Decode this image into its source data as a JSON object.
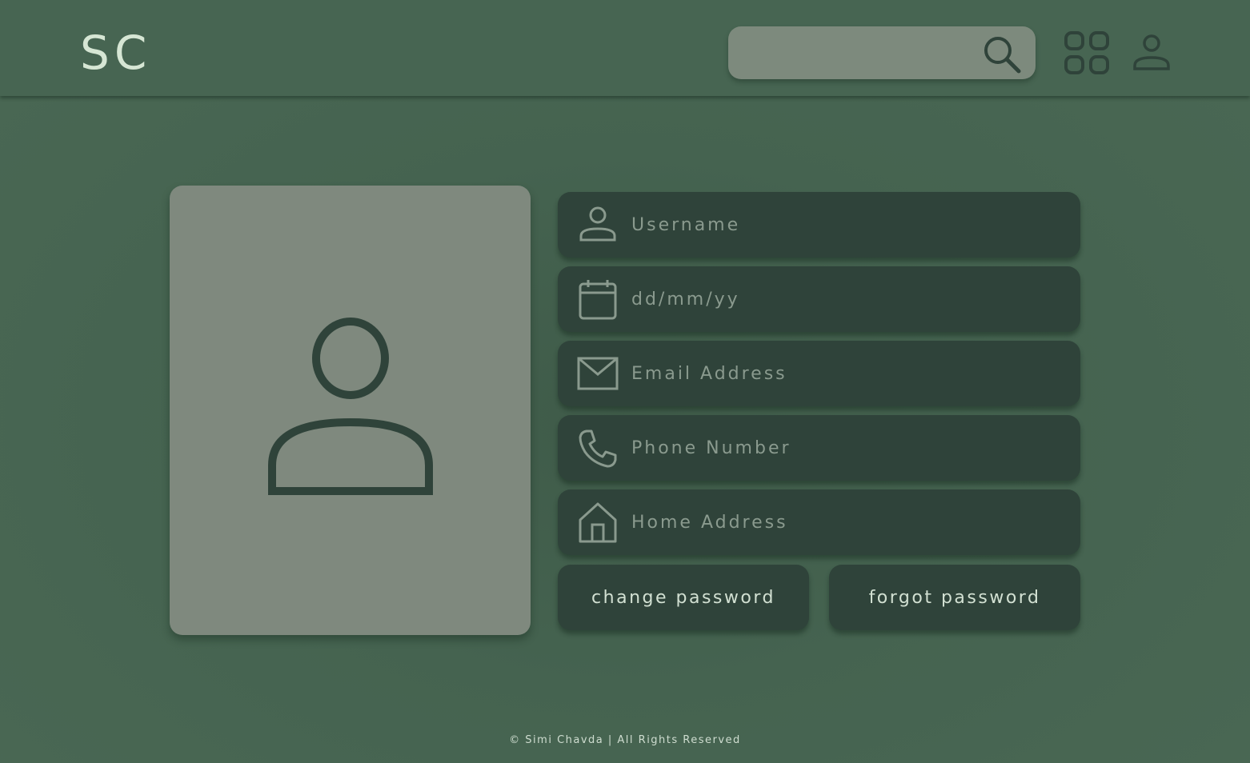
{
  "header": {
    "logo": "SC",
    "search": {
      "placeholder": "",
      "icon": "search-icon"
    },
    "apps_icon": "apps-grid-icon",
    "profile_icon": "user-icon"
  },
  "profile": {
    "photo_icon": "user-avatar-icon"
  },
  "form": {
    "fields": [
      {
        "icon": "user-icon",
        "placeholder": "Username"
      },
      {
        "icon": "calendar-icon",
        "placeholder": "dd/mm/yy"
      },
      {
        "icon": "envelope-icon",
        "placeholder": "Email Address"
      },
      {
        "icon": "phone-icon",
        "placeholder": "Phone Number"
      },
      {
        "icon": "home-icon",
        "placeholder": "Home Address"
      }
    ],
    "change_password_label": "change password",
    "forgot_password_label": "forgot password"
  },
  "footer": {
    "text": "© Simi Chavda | All Rights Reserved"
  },
  "colors": {
    "background": "#456350",
    "field_bg": "#2f433a",
    "card_bg": "#7f897e",
    "logo_text": "#d6e6d4"
  }
}
